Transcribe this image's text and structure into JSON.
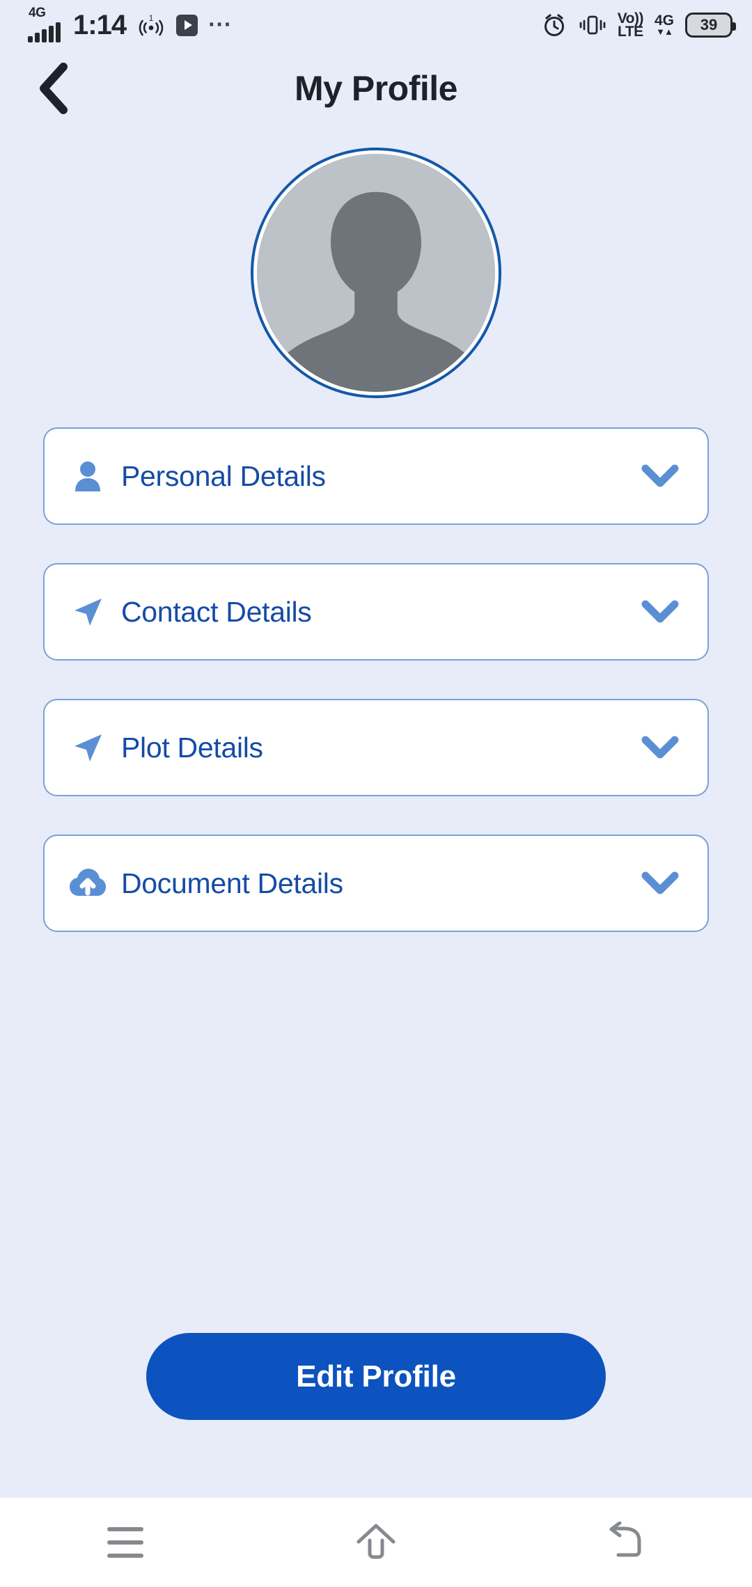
{
  "status_bar": {
    "network_type": "4G",
    "time": "1:14",
    "hotspot_badge": "1",
    "hotspot_icon": "hotspot-icon",
    "media_icon": "play-icon",
    "overflow_icon": "more-dots-icon",
    "alarm_icon": "alarm-clock-icon",
    "vibrate_icon": "vibrate-icon",
    "volte_top": "Vo))",
    "volte_bottom": "LTE",
    "data_network": "4G",
    "data_arrows": "▼▲",
    "battery_level": "39"
  },
  "header": {
    "back_icon": "chevron-left-icon",
    "title": "My Profile"
  },
  "avatar": {
    "icon": "profile-placeholder-avatar",
    "ring_color": "#1458a8",
    "fill_color": "#bdc2c8",
    "silhouette_color": "#6e7479"
  },
  "sections": [
    {
      "label": "Personal Details",
      "icon": "person-icon",
      "chevron": "chevron-down-icon",
      "expanded": false
    },
    {
      "label": "Contact Details",
      "icon": "navigation-arrow-icon",
      "chevron": "chevron-down-icon",
      "expanded": false
    },
    {
      "label": "Plot Details",
      "icon": "navigation-arrow-icon",
      "chevron": "chevron-down-icon",
      "expanded": false
    },
    {
      "label": "Document Details",
      "icon": "cloud-upload-icon",
      "chevron": "chevron-down-icon",
      "expanded": false
    }
  ],
  "cta": {
    "label": "Edit Profile",
    "color": "#0d53bf",
    "text_color": "#ffffff"
  },
  "nav_bar": {
    "recents_icon": "menu-lines-icon",
    "home_icon": "home-icon",
    "back_icon": "back-arrow-icon",
    "icon_color": "#86898e"
  },
  "theme": {
    "page_background": "#e7ecf8",
    "card_background": "#ffffff",
    "card_border": "#7ba1d4",
    "accent_text": "#154ba6",
    "accent_icon": "#5b8fd4"
  }
}
